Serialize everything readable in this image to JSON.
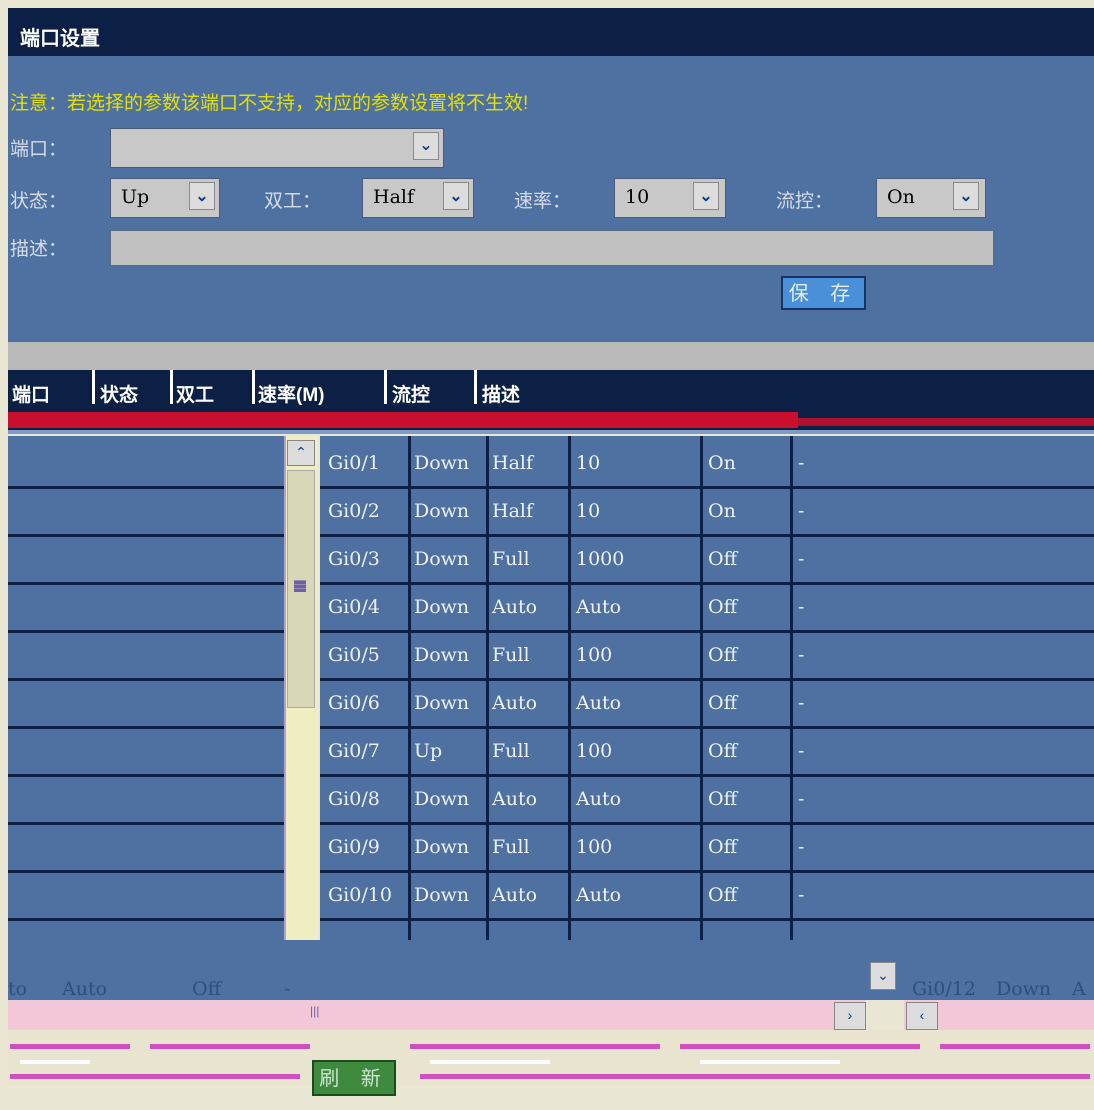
{
  "page": {
    "title": "端口设置"
  },
  "form": {
    "notice": "注意：若选择的参数该端口不支持，对应的参数设置将不生效!",
    "port_label": "端口：",
    "port_value": "",
    "status_label": "状态：",
    "status_value": "Up",
    "duplex_label": "双工：",
    "duplex_value": "Half",
    "speed_label": "速率：",
    "speed_value": "10",
    "flow_label": "流控：",
    "flow_value": "On",
    "desc_label": "描述：",
    "desc_value": "",
    "save_label": "保 存"
  },
  "table": {
    "headers": [
      "端口",
      "状态",
      "双工",
      "速率(M)",
      "流控",
      "描述"
    ],
    "rows": [
      {
        "port": "Gi0/1",
        "status": "Down",
        "duplex": "Half",
        "speed": "10",
        "flow": "On",
        "desc": "-"
      },
      {
        "port": "Gi0/2",
        "status": "Down",
        "duplex": "Half",
        "speed": "10",
        "flow": "On",
        "desc": "-"
      },
      {
        "port": "Gi0/3",
        "status": "Down",
        "duplex": "Full",
        "speed": "1000",
        "flow": "Off",
        "desc": "-"
      },
      {
        "port": "Gi0/4",
        "status": "Down",
        "duplex": "Auto",
        "speed": "Auto",
        "flow": "Off",
        "desc": "-"
      },
      {
        "port": "Gi0/5",
        "status": "Down",
        "duplex": "Full",
        "speed": "100",
        "flow": "Off",
        "desc": "-"
      },
      {
        "port": "Gi0/6",
        "status": "Down",
        "duplex": "Auto",
        "speed": "Auto",
        "flow": "Off",
        "desc": "-"
      },
      {
        "port": "Gi0/7",
        "status": "Up",
        "duplex": "Full",
        "speed": "100",
        "flow": "Off",
        "desc": "-"
      },
      {
        "port": "Gi0/8",
        "status": "Down",
        "duplex": "Auto",
        "speed": "Auto",
        "flow": "Off",
        "desc": "-"
      },
      {
        "port": "Gi0/9",
        "status": "Down",
        "duplex": "Full",
        "speed": "100",
        "flow": "Off",
        "desc": "-"
      },
      {
        "port": "Gi0/10",
        "status": "Down",
        "duplex": "Auto",
        "speed": "Auto",
        "flow": "Off",
        "desc": "-"
      }
    ],
    "partial_row_a": {
      "duplex_tail": "to",
      "speed": "Auto",
      "flow": "Off",
      "desc": "-"
    },
    "partial_row_b": {
      "port": "Gi0/12",
      "status": "Down",
      "duplex_head": "A"
    }
  },
  "refresh_label": "刷 新",
  "icons": {
    "dropdown": "chevron-down-icon",
    "scroll_up": "chevron-up-icon",
    "scroll_right": "chevron-right-icon",
    "scroll_left": "chevron-left-icon"
  }
}
